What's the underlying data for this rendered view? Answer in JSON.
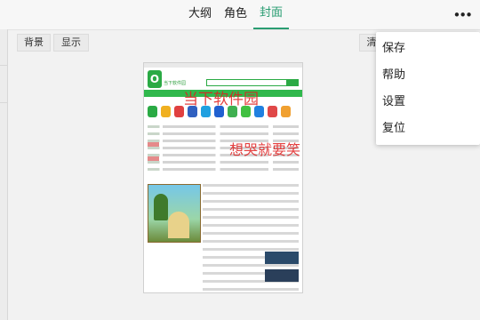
{
  "tabs": [
    {
      "label": "大纲"
    },
    {
      "label": "角色"
    },
    {
      "label": "封面",
      "active": true
    }
  ],
  "more_icon": "more-dots-icon",
  "toolbar": {
    "background_label": "背景",
    "display_label": "显示",
    "clear_label": "清"
  },
  "menu": {
    "items": [
      {
        "label": "保存"
      },
      {
        "label": "帮助"
      },
      {
        "label": "设置"
      },
      {
        "label": "复位"
      }
    ]
  },
  "cover": {
    "site_name": "当下软件园",
    "watermark_1": "当下软件园",
    "watermark_2": "想哭就要笑"
  },
  "colors": {
    "accent": "#2a9d72",
    "site_green": "#2aaa44",
    "watermark": "#e02020"
  }
}
